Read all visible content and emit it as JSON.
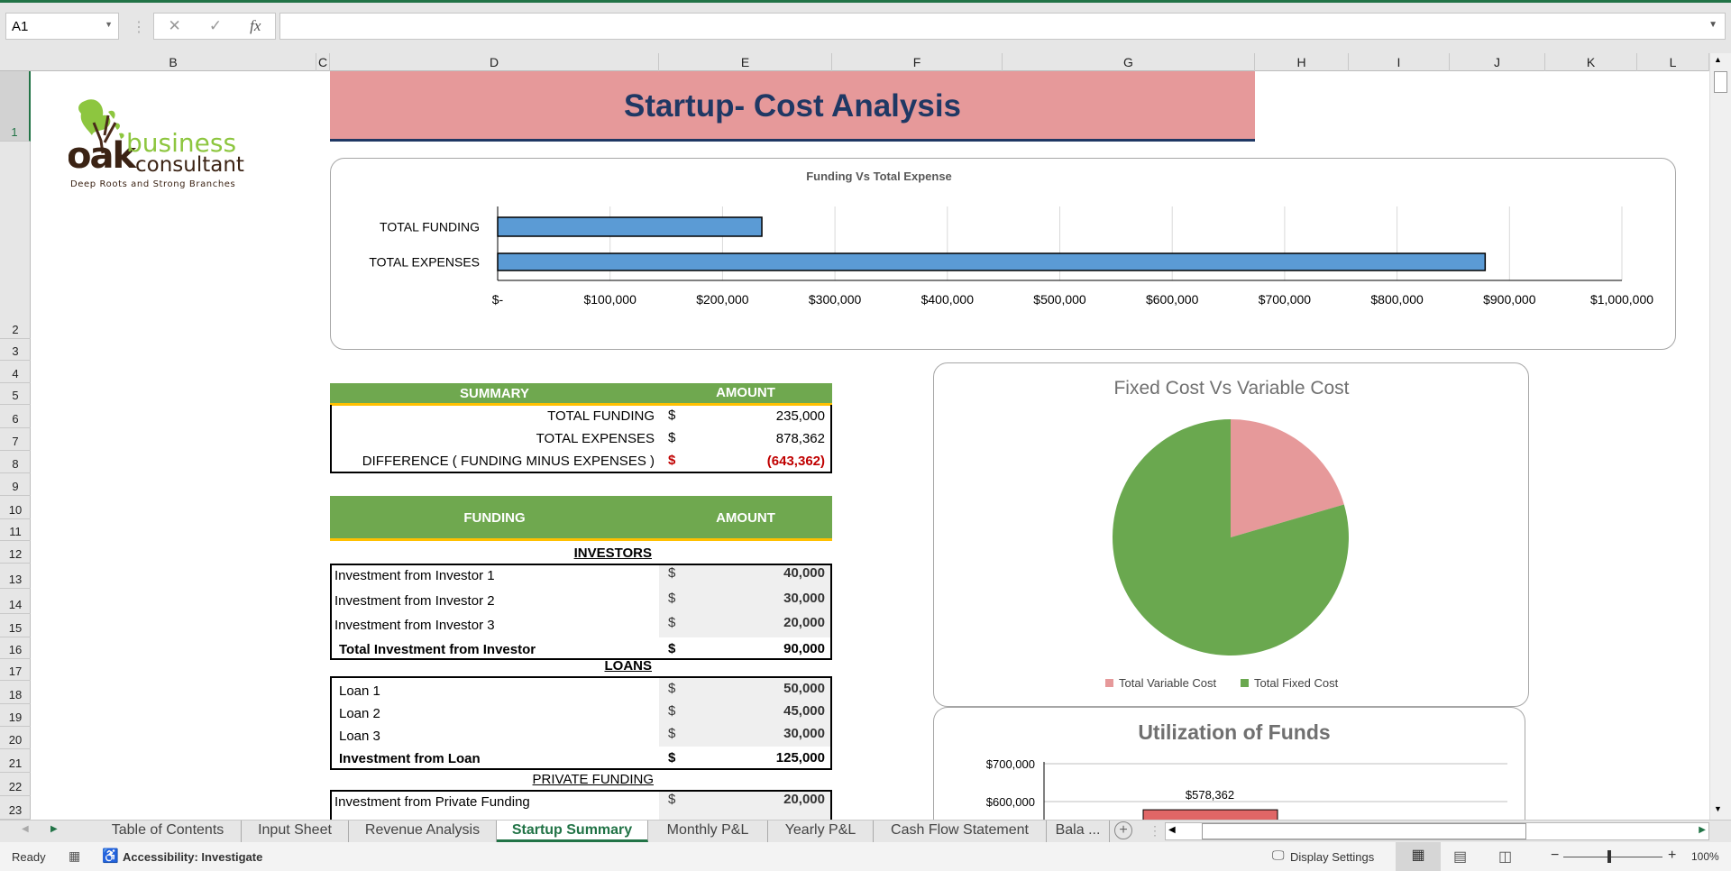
{
  "formula_bar": {
    "name_box": "A1",
    "cancel_icon": "✕",
    "enter_icon": "✓",
    "fx_label": "fx",
    "formula": ""
  },
  "columns": [
    "B",
    "C",
    "D",
    "E",
    "F",
    "G",
    "H",
    "I",
    "J",
    "K",
    "L"
  ],
  "rows": [
    "1",
    "2",
    "3",
    "4",
    "5",
    "6",
    "7",
    "8",
    "9",
    "10",
    "11",
    "12",
    "13",
    "14",
    "15",
    "16",
    "17",
    "18",
    "19",
    "20",
    "21",
    "22",
    "23"
  ],
  "logo": {
    "word1": "oak",
    "word2": "business",
    "word3": "consultant",
    "tagline": "Deep Roots and Strong Branches"
  },
  "title": "Startup- Cost Analysis",
  "summary": {
    "header": "SUMMARY",
    "amount_header": "AMOUNT",
    "rows": [
      {
        "label": "TOTAL FUNDING",
        "currency": "$",
        "amount": "235,000"
      },
      {
        "label": "TOTAL EXPENSES",
        "currency": "$",
        "amount": "878,362"
      },
      {
        "label": "DIFFERENCE  ( FUNDING MINUS EXPENSES )",
        "currency": "$",
        "amount": "(643,362)"
      }
    ]
  },
  "funding": {
    "header": "FUNDING",
    "amount_header": "AMOUNT",
    "investors": {
      "title": "INVESTORS",
      "rows": [
        {
          "label": "Investment from Investor 1",
          "currency": "$",
          "amount": "40,000"
        },
        {
          "label": "Investment from Investor 2",
          "currency": "$",
          "amount": "30,000"
        },
        {
          "label": "Investment from Investor 3",
          "currency": "$",
          "amount": "20,000"
        }
      ],
      "total": {
        "label": "Total Investment from Investor",
        "currency": "$",
        "amount": "90,000"
      }
    },
    "loans": {
      "title": "LOANS",
      "rows": [
        {
          "label": "Loan 1",
          "currency": "$",
          "amount": "50,000"
        },
        {
          "label": "Loan 2",
          "currency": "$",
          "amount": "45,000"
        },
        {
          "label": "Loan 3",
          "currency": "$",
          "amount": "30,000"
        }
      ],
      "total": {
        "label": "Investment from Loan",
        "currency": "$",
        "amount": "125,000"
      }
    },
    "private": {
      "title": "PRIVATE FUNDING",
      "rows": [
        {
          "label": "Investment from Private Funding",
          "currency": "$",
          "amount": "20,000"
        }
      ]
    }
  },
  "colors": {
    "green_header": "#6FA84F",
    "gold_line": "#FFC000",
    "title_bg": "#E6999A",
    "title_text": "#1F3864",
    "negative": "#C00000",
    "bar_blue": "#5B9BD5",
    "pie_variable": "#E6999A",
    "pie_fixed": "#6AA84F",
    "util_bar": "#E06666",
    "excel_green": "#217346"
  },
  "chart_data": [
    {
      "type": "bar",
      "orientation": "horizontal",
      "title": "Funding Vs Total Expense",
      "categories": [
        "TOTAL FUNDING",
        "TOTAL EXPENSES"
      ],
      "values": [
        235000,
        878362
      ],
      "xlim": [
        0,
        1000000
      ],
      "tick_labels": [
        "$-",
        "$100,000",
        "$200,000",
        "$300,000",
        "$400,000",
        "$500,000",
        "$600,000",
        "$700,000",
        "$800,000",
        "$900,000",
        "$1,000,000"
      ],
      "grid": true
    },
    {
      "type": "pie",
      "title": "Fixed Cost Vs Variable Cost",
      "labels": [
        "Total Variable Cost",
        "Total Fixed Cost"
      ],
      "fractions": [
        0.205,
        0.795
      ],
      "legend": "bottom"
    },
    {
      "type": "bar",
      "title": "Utilization of Funds",
      "tick_labels": [
        "$700,000",
        "$600,000"
      ],
      "ticks": [
        700000,
        600000
      ],
      "values": [
        578362
      ],
      "data_labels": [
        "$578,362"
      ],
      "grid": true
    }
  ],
  "sheet_tabs": {
    "tabs": [
      "Table of Contents",
      "Input Sheet",
      "Revenue Analysis",
      "Startup Summary",
      "Monthly P&L",
      "Yearly P&L",
      "Cash Flow Statement",
      "Bala ..."
    ],
    "active": "Startup Summary"
  },
  "status_bar": {
    "ready": "Ready",
    "accessibility": "Accessibility: Investigate",
    "display_settings": "Display Settings",
    "zoom": "100%",
    "zoom_level_percent": 100
  }
}
